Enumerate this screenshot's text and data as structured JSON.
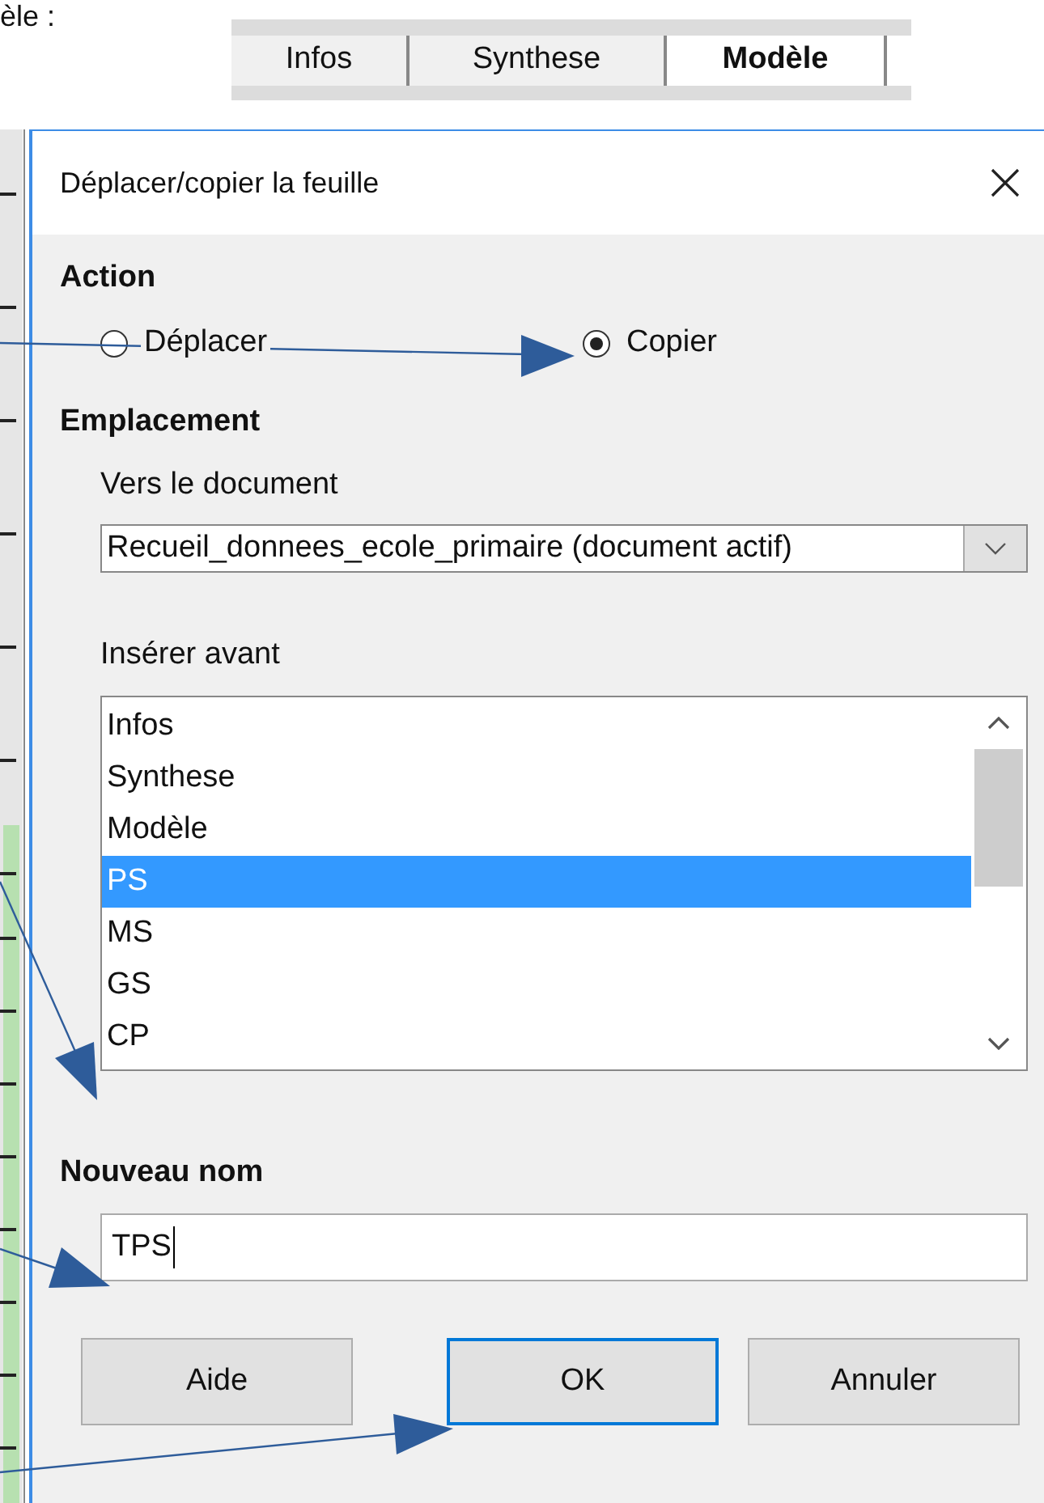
{
  "caption": "èle :",
  "sheet_tabs": [
    {
      "label": "Infos",
      "selected": false
    },
    {
      "label": "Synthese",
      "selected": false
    },
    {
      "label": "Modèle",
      "selected": true
    }
  ],
  "dialog": {
    "title": "Déplacer/copier la feuille",
    "action": {
      "heading": "Action",
      "options": [
        {
          "label": "Déplacer",
          "selected": false
        },
        {
          "label": "Copier",
          "selected": true
        }
      ]
    },
    "location": {
      "heading": "Emplacement",
      "document_label": {
        "text": "Vers le document"
      },
      "document": "Recueil_donnees_ecole_primaire (document actif)",
      "insert_label": {
        "text": "Insérer avant"
      },
      "sheets": [
        {
          "label": "Infos",
          "selected": false
        },
        {
          "label": "Synthese",
          "selected": false
        },
        {
          "label": "Modèle",
          "selected": false
        },
        {
          "label": "PS",
          "selected": true
        },
        {
          "label": "MS",
          "selected": false
        },
        {
          "label": "GS",
          "selected": false
        },
        {
          "label": "CP",
          "selected": false
        }
      ]
    },
    "new_name": {
      "label": "Nouveau nom",
      "value": "TPS"
    },
    "buttons": [
      {
        "label": "Aide",
        "default": false
      },
      {
        "label": "OK",
        "default": true
      },
      {
        "label": "Annuler",
        "default": false
      }
    ]
  }
}
